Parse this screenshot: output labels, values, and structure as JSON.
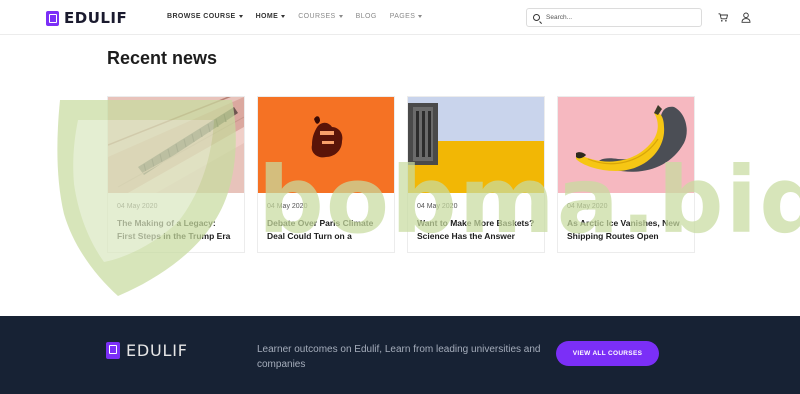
{
  "brand": {
    "name": "EDULIF",
    "accent": "#7b2ff7"
  },
  "nav": {
    "items": [
      {
        "label": "Browse Course",
        "has_menu": true,
        "active": true
      },
      {
        "label": "Home",
        "has_menu": true,
        "active": true
      },
      {
        "label": "Courses",
        "has_menu": true,
        "active": false
      },
      {
        "label": "Blog",
        "has_menu": false,
        "active": false
      },
      {
        "label": "Pages",
        "has_menu": true,
        "active": false
      }
    ]
  },
  "search": {
    "placeholder": "Search..."
  },
  "header_icons": [
    "cart-icon",
    "user-icon"
  ],
  "section": {
    "title": "Recent news"
  },
  "cards": [
    {
      "date": "04 May 2020",
      "title": "The Making of a Legacy: First Steps in the Trump Era",
      "image": "escalator"
    },
    {
      "date": "04 May 2020",
      "title": "Debate Over Paris Climate Deal Could Turn on a Single...",
      "image": "orange-figure"
    },
    {
      "date": "04 May 2020",
      "title": "Want to Make More Baskets? Science Has the Answer",
      "image": "yellow-wall"
    },
    {
      "date": "04 May 2020",
      "title": "As Arctic Ice Vanishes, New Shipping Routes Open",
      "image": "banana"
    }
  ],
  "footer": {
    "brand": "EDULIF",
    "text": "Learner outcomes on Edulif, Learn from leading universities and companies",
    "button": "View all courses",
    "background": "#172234"
  },
  "watermark": {
    "text": "bobma.bid",
    "color": "#c8dca0"
  }
}
